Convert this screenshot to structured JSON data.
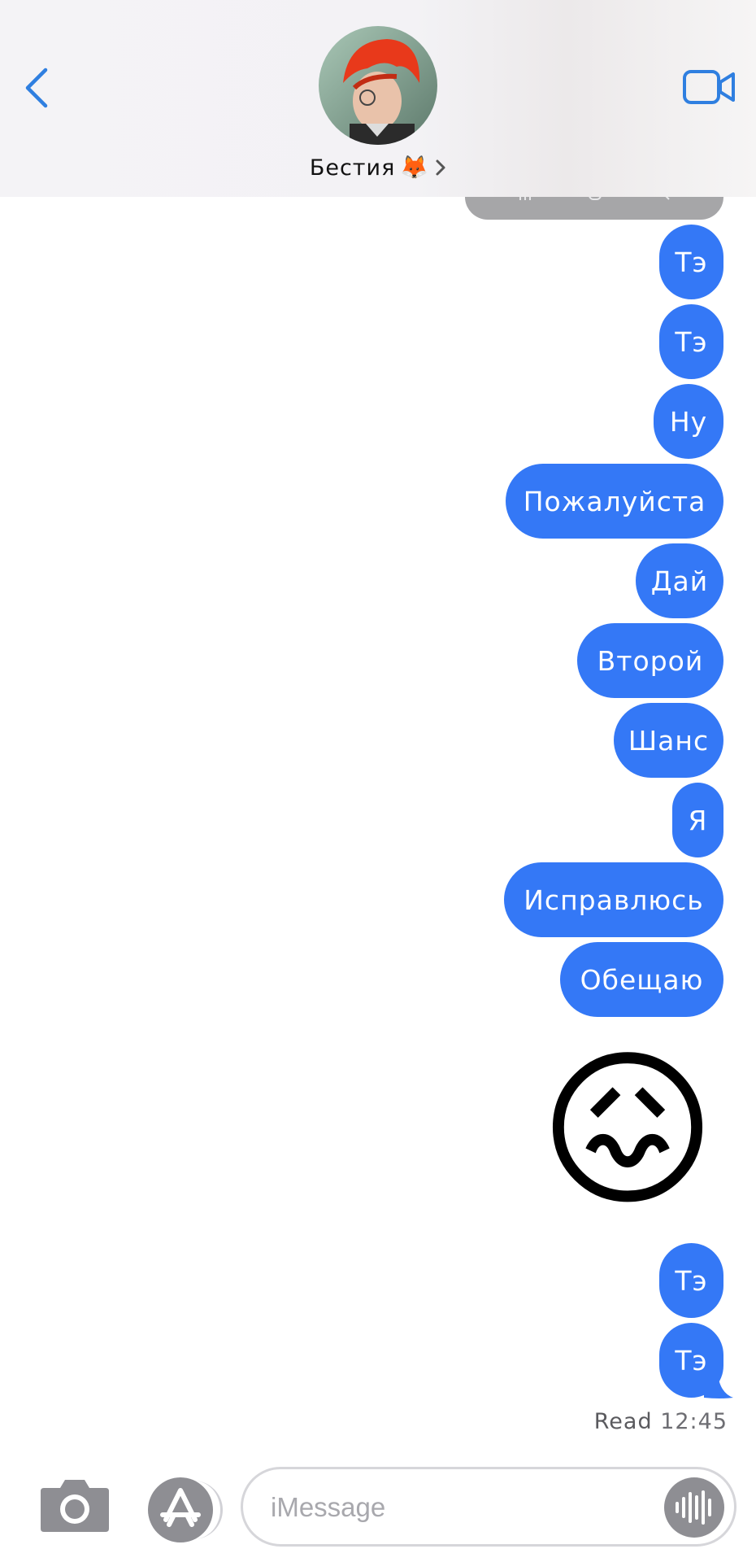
{
  "header": {
    "contact_name": "Бестия",
    "contact_emoji": "🦊",
    "back_icon": "chevron-left-icon",
    "video_icon": "video-camera-icon",
    "accent_color": "#2f7fe0"
  },
  "messages": [
    {
      "text": "Тэ"
    },
    {
      "text": "Тэ"
    },
    {
      "text": "Ну"
    },
    {
      "text": "Пожалуйста"
    },
    {
      "text": "Дай"
    },
    {
      "text": "Второй"
    },
    {
      "text": "Шанс"
    },
    {
      "text": "Я"
    },
    {
      "text": "Исправлюсь"
    },
    {
      "text": "Обещаю"
    },
    {
      "emoji": "😖"
    },
    {
      "text": "Тэ"
    },
    {
      "text": "Тэ"
    }
  ],
  "receipt": {
    "status": "Read",
    "time": "12:45"
  },
  "composer": {
    "placeholder": "iMessage",
    "camera_icon": "camera-icon",
    "apps_icon": "app-store-icon",
    "audio_icon": "waveform-icon"
  },
  "colors": {
    "bubble": "#3478f6",
    "bubble_text": "#ffffff"
  }
}
